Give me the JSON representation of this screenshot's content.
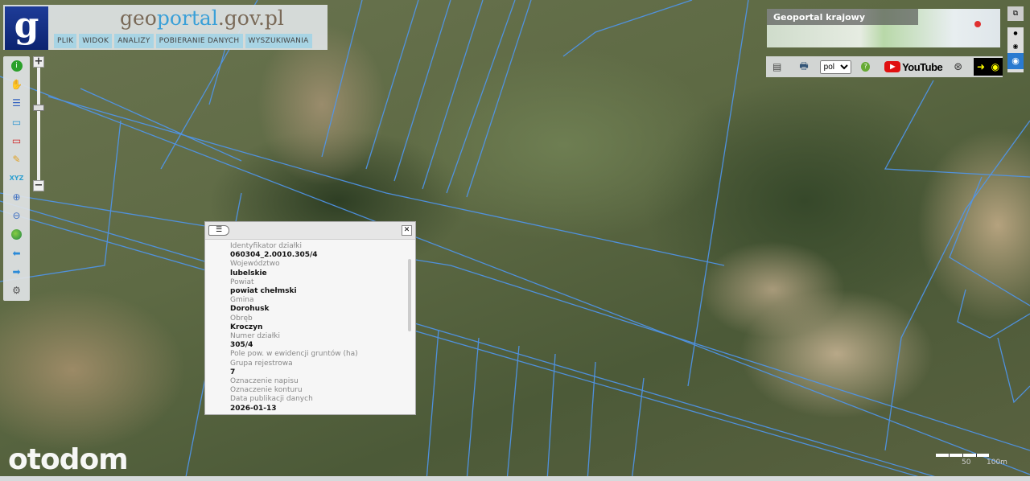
{
  "header": {
    "brand_prefix": "geo",
    "brand_main": "portal",
    "brand_suffix": ".gov.pl",
    "logo_letter": "g",
    "menu": [
      "PLIK",
      "WIDOK",
      "ANALIZY",
      "POBIERANIE DANYCH",
      "WYSZUKIWANIA"
    ]
  },
  "overview": {
    "title": "Geoportal krajowy"
  },
  "right_toolbar": {
    "language": "pol",
    "youtube": "YouTube"
  },
  "zoom": {
    "plus": "+",
    "minus": "−",
    "level_fraction": 0.35
  },
  "popup": {
    "fields": [
      {
        "label": "Identyfikator działki",
        "value": "060304_2.0010.305/4"
      },
      {
        "label": "Województwo",
        "value": "lubelskie"
      },
      {
        "label": "Powiat",
        "value": "powiat chełmski"
      },
      {
        "label": "Gmina",
        "value": "Dorohusk"
      },
      {
        "label": "Obręb",
        "value": "Kroczyn"
      },
      {
        "label": "Numer działki",
        "value": "305/4"
      },
      {
        "label": "Pole pow. w ewidencji gruntów (ha)",
        "value": ""
      },
      {
        "label": "Grupa rejestrowa",
        "value": "7"
      },
      {
        "label": "Oznaczenie napisu",
        "value": ""
      },
      {
        "label": "Oznaczenie konturu",
        "value": ""
      },
      {
        "label": "Data publikacji danych",
        "value": "2026-01-13"
      }
    ]
  },
  "watermark": "otodom",
  "scale": {
    "mid": "50",
    "end": "100m"
  },
  "colors": {
    "parcel_line": "#4a90e8",
    "menu_bg": "#a8d4e4",
    "logo_bg": "#1e3c98"
  }
}
